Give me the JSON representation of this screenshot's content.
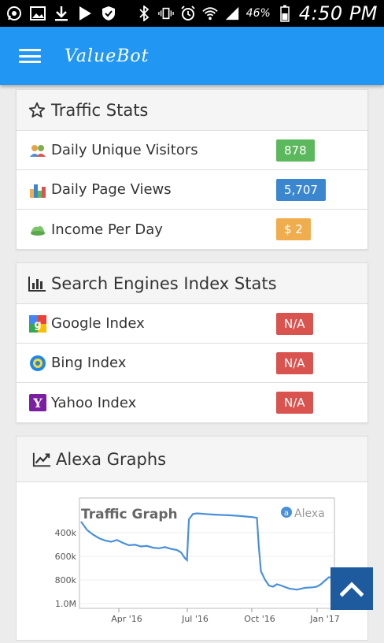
{
  "status_bar": {
    "battery": "46%",
    "time": "4:50 PM"
  },
  "app": {
    "title": "ValueBot"
  },
  "traffic": {
    "title": "Traffic Stats",
    "rows": [
      {
        "label": "Daily Unique Visitors",
        "value": "878",
        "color": "#5cb85c"
      },
      {
        "label": "Daily Page Views",
        "value": "5,707",
        "color": "#3a87d0"
      },
      {
        "label": "Income Per Day",
        "value": "$ 2",
        "color": "#f0ad4e"
      }
    ]
  },
  "index": {
    "title": "Search Engines Index Stats",
    "rows": [
      {
        "label": "Google Index",
        "value": "N/A",
        "color": "#d9534f"
      },
      {
        "label": "Bing Index",
        "value": "N/A",
        "color": "#d9534f"
      },
      {
        "label": "Yahoo Index",
        "value": "N/A",
        "color": "#d9534f"
      }
    ]
  },
  "alexa": {
    "title": "Alexa Graphs",
    "chart_data": {
      "type": "line",
      "title": "Traffic Graph",
      "brand": "Alexa",
      "y_ticks": [
        "400k",
        "600k",
        "800k",
        "1.0M"
      ],
      "x_ticks": [
        "Apr '16",
        "Jul '16",
        "Oct '16",
        "Jan '17"
      ],
      "y_range": [
        300000,
        1000000
      ],
      "y_reversed": true,
      "series": [
        {
          "values": [
            [
              0,
              300000
            ],
            [
              3,
              370000
            ],
            [
              6,
              410000
            ],
            [
              9,
              440000
            ],
            [
              12,
              460000
            ],
            [
              15,
              470000
            ],
            [
              18,
              455000
            ],
            [
              21,
              480000
            ],
            [
              24,
              500000
            ],
            [
              27,
              495000
            ],
            [
              30,
              510000
            ],
            [
              33,
              505000
            ],
            [
              36,
              520000
            ],
            [
              39,
              525000
            ],
            [
              42,
              515000
            ],
            [
              45,
              530000
            ],
            [
              48,
              540000
            ],
            [
              50,
              560000
            ],
            [
              52,
              610000
            ],
            [
              53,
              625000
            ],
            [
              54,
              280000
            ],
            [
              56,
              235000
            ],
            [
              58,
              230000
            ],
            [
              62,
              235000
            ],
            [
              66,
              240000
            ],
            [
              70,
              243000
            ],
            [
              74,
              246000
            ],
            [
              78,
              250000
            ],
            [
              82,
              256000
            ],
            [
              86,
              262000
            ],
            [
              88,
              268000
            ],
            [
              89,
              520000
            ],
            [
              90,
              720000
            ],
            [
              92,
              790000
            ],
            [
              94,
              840000
            ],
            [
              96,
              850000
            ],
            [
              98,
              830000
            ],
            [
              100,
              840000
            ],
            [
              104,
              865000
            ],
            [
              108,
              875000
            ],
            [
              112,
              860000
            ],
            [
              116,
              855000
            ],
            [
              118,
              850000
            ],
            [
              120,
              830000
            ],
            [
              122,
              800000
            ],
            [
              124,
              770000
            ],
            [
              126,
              775000
            ]
          ],
          "color": "#4a90d9"
        }
      ]
    }
  }
}
